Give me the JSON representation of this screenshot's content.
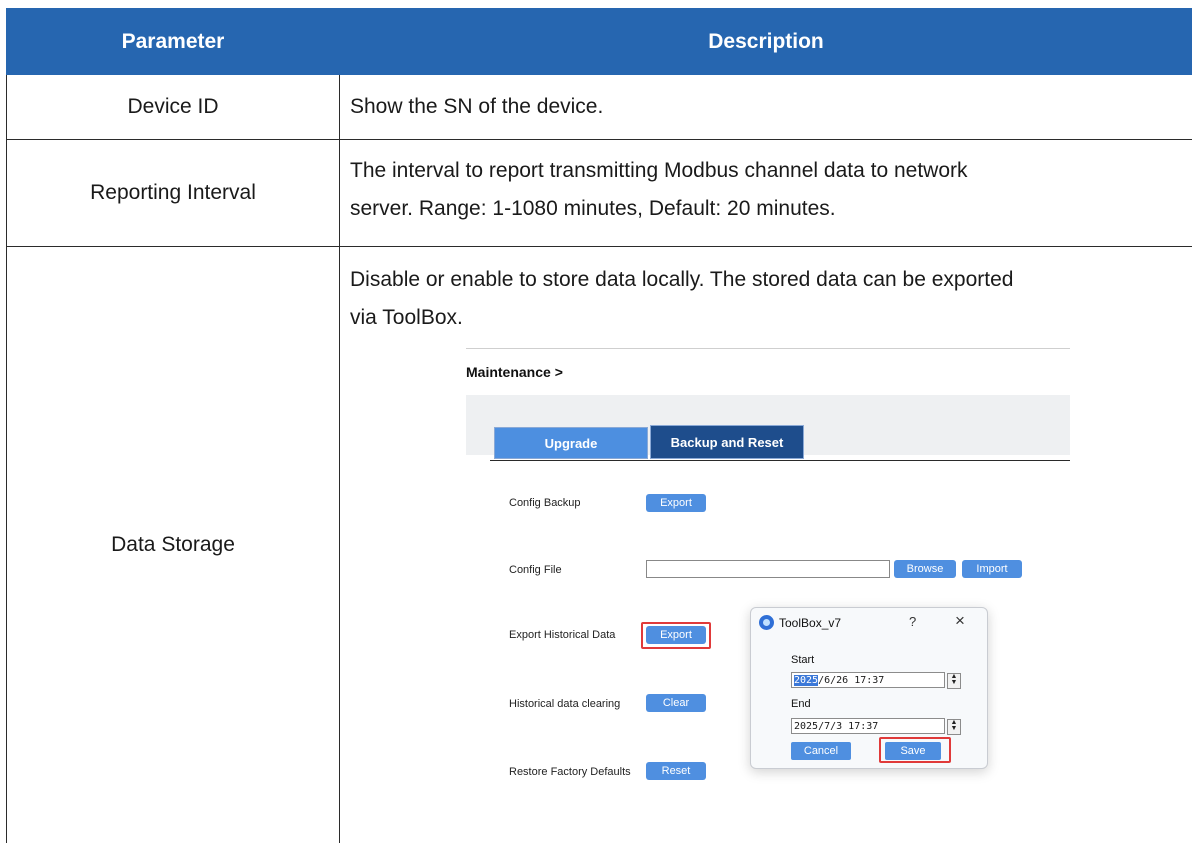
{
  "table": {
    "header": {
      "parameter": "Parameter",
      "description": "Description"
    },
    "rows": [
      {
        "parameter": "Device ID",
        "description_lines": [
          "Show the SN of the device."
        ]
      },
      {
        "parameter": "Reporting Interval",
        "description_lines": [
          "The interval to report transmitting Modbus channel data to network",
          "server. Range: 1-1080 minutes, Default: 20 minutes."
        ]
      },
      {
        "parameter": "Data Storage",
        "description_lines": [
          "Disable or enable to store data locally. The stored data can be exported",
          "via ToolBox."
        ]
      }
    ]
  },
  "screenshot": {
    "breadcrumb": "Maintenance >",
    "tabs": [
      "Upgrade",
      "Backup and Reset"
    ],
    "active_tab": "Backup and Reset",
    "rows": [
      {
        "label": "Config Backup",
        "buttons": [
          "Export"
        ]
      },
      {
        "label": "Config File",
        "buttons": [
          "Browse",
          "Import"
        ]
      },
      {
        "label": "Export Historical Data",
        "buttons": [
          "Export"
        ]
      },
      {
        "label": "Historical data clearing",
        "buttons": [
          "Clear"
        ]
      },
      {
        "label": "Restore Factory Defaults",
        "buttons": [
          "Reset"
        ]
      }
    ],
    "dialog": {
      "title": "ToolBox_v7",
      "help_glyph": "?",
      "close_glyph": "×",
      "start_label": "Start",
      "start_year": "2025",
      "start_rest": "/6/26 17:37",
      "end_label": "End",
      "end_value": "2025/7/3 17:37",
      "cancel_label": "Cancel",
      "save_label": "Save"
    },
    "colors": {
      "header": "#2666b0",
      "button": "#4f8fe0",
      "active_tab": "#1e4d8c",
      "highlight": "#e03a3a"
    }
  }
}
